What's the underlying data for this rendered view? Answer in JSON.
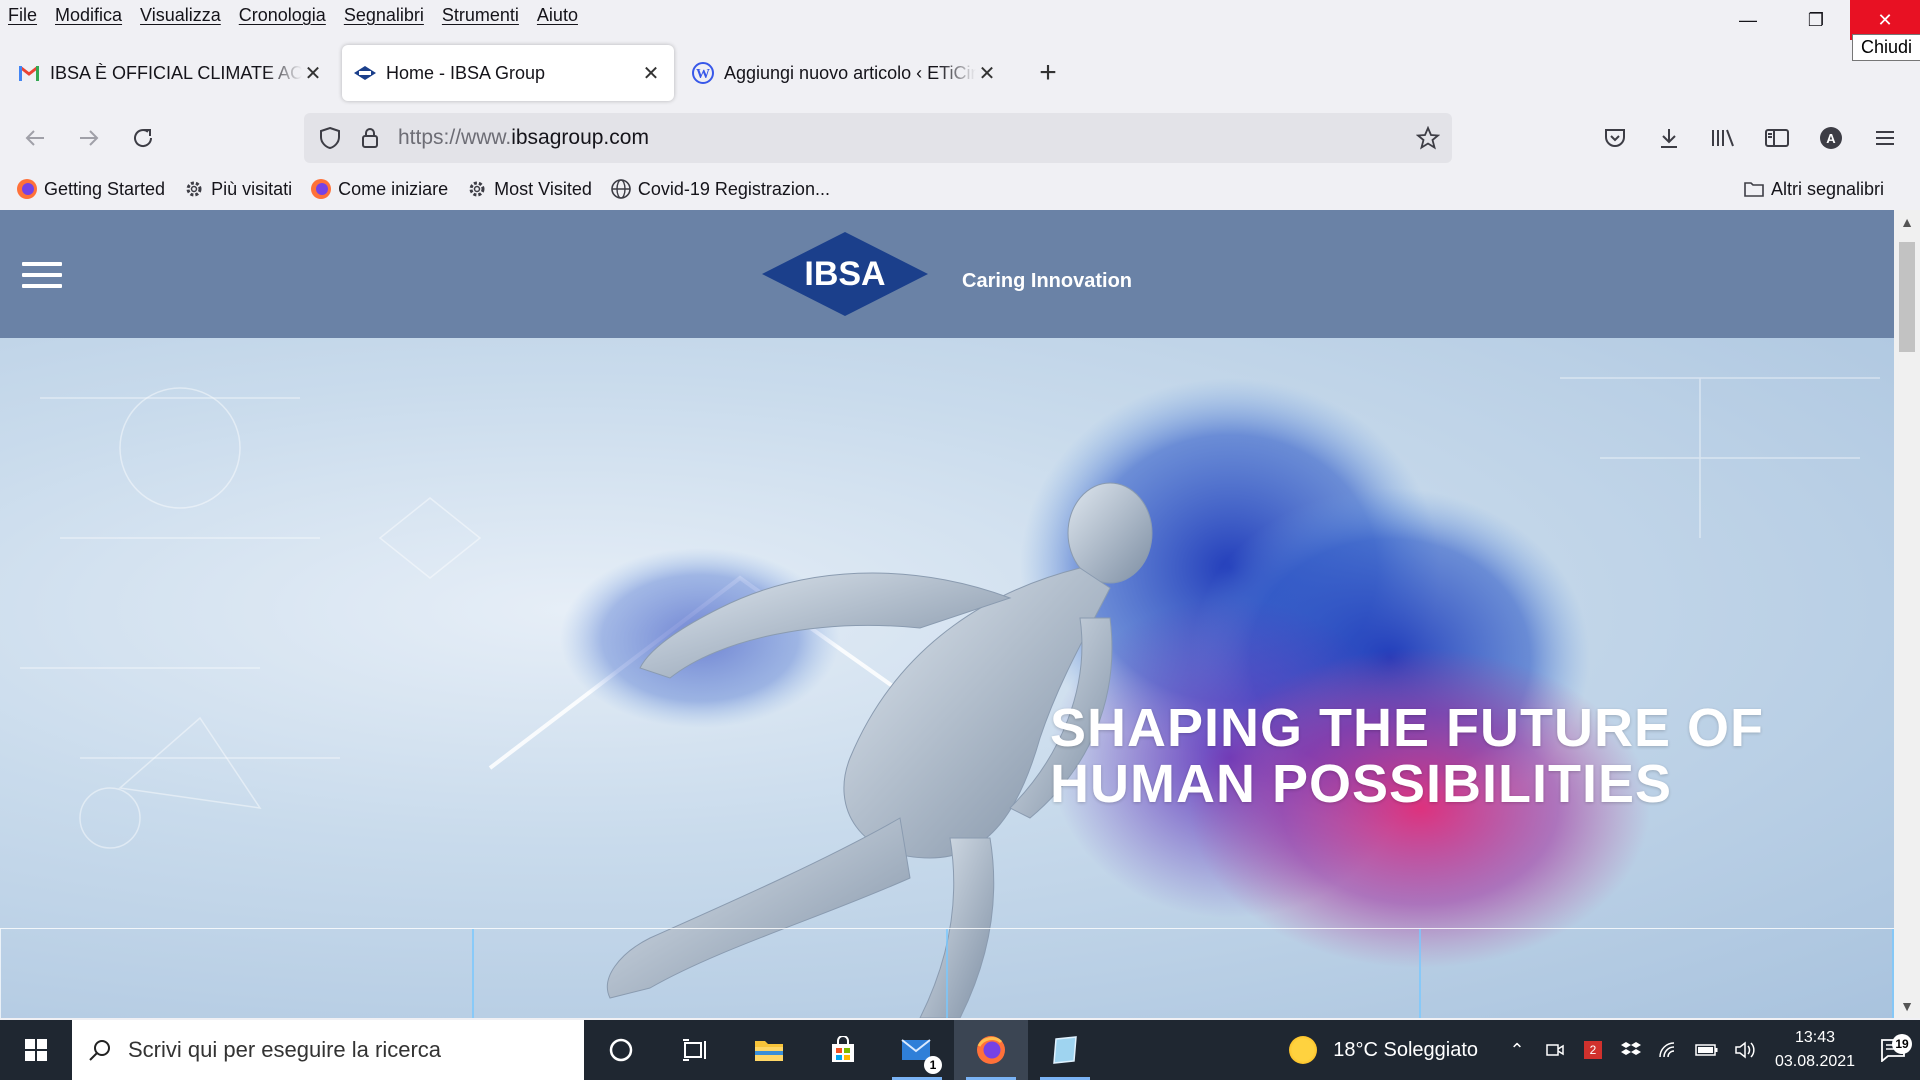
{
  "menubar": {
    "items": [
      "File",
      "Modifica",
      "Visualizza",
      "Cronologia",
      "Segnalibri",
      "Strumenti",
      "Aiuto"
    ]
  },
  "window": {
    "close_tooltip": "Chiudi",
    "minimize_glyph": "—",
    "maximize_glyph": "❐",
    "close_glyph": "✕"
  },
  "tabs": [
    {
      "label": "IBSA È OFFICIAL CLIMATE ACTION",
      "icon": "gmail-icon",
      "active": false
    },
    {
      "label": "Home - IBSA Group",
      "icon": "ibsa-favicon",
      "active": true
    },
    {
      "label": "Aggiungi nuovo articolo ‹ ETiCinforma",
      "icon": "wordpress-icon",
      "active": false
    }
  ],
  "tab_close_glyph": "✕",
  "newtab_glyph": "+",
  "nav": {
    "url_prefix": "https://www.",
    "url_domain": "ibsagroup.com"
  },
  "bookmarks": [
    {
      "label": "Getting Started",
      "icon": "firefox-icon"
    },
    {
      "label": "Più visitati",
      "icon": "gear-icon"
    },
    {
      "label": "Come iniziare",
      "icon": "firefox-icon"
    },
    {
      "label": "Most Visited",
      "icon": "gear-icon"
    },
    {
      "label": "Covid-19 Registrazion...",
      "icon": "globe-icon"
    }
  ],
  "other_bookmarks": "Altri segnalibri",
  "site": {
    "logo_text": "IBSA",
    "tagline": "Caring Innovation",
    "hero_line1": "SHAPING THE FUTURE OF",
    "hero_line2": "HUMAN POSSIBILITIES"
  },
  "taskbar": {
    "search_placeholder": "Scrivi qui per eseguire la ricerca",
    "weather": "18°C  Soleggiato",
    "time": "13:43",
    "date": "03.08.2021",
    "notification_count": "19",
    "mail_badge": "1",
    "tray_badge": "2"
  },
  "colors": {
    "header_bg": "#6a82a6",
    "ibsa_blue": "#1b3f8b",
    "taskbar_bg": "#1f2731",
    "close_red": "#e81123"
  }
}
